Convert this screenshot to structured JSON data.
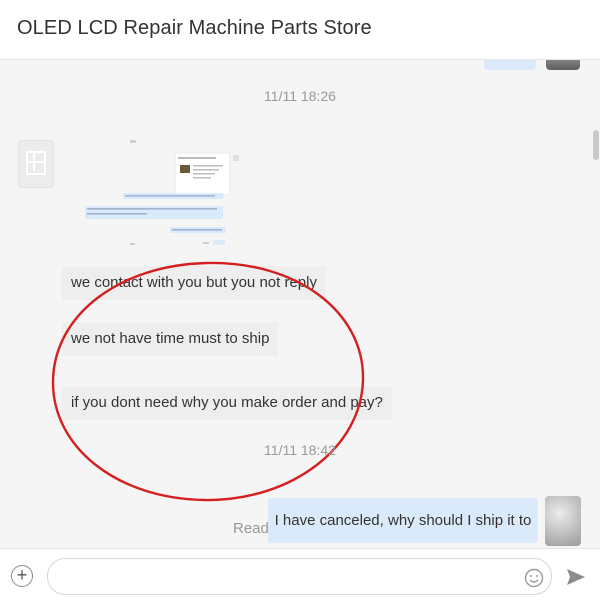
{
  "header": {
    "title": "OLED LCD Repair Machine Parts Store"
  },
  "chat": {
    "timestamps": [
      "11/11 18:26",
      "11/11 18:42"
    ],
    "shop_messages": [
      "we contact with you but you not reply",
      "we not have time must to ship",
      "if you dont need why you make order and pay?"
    ],
    "my_message": "I have canceled, why should I ship it to me?",
    "read_status": "Read"
  },
  "footer": {
    "input_value": "",
    "input_placeholder": ""
  },
  "icons": {
    "shop_avatar": "store-icon",
    "attach": "plus-icon",
    "emoji": "smiley-icon",
    "send": "send-arrow-icon"
  },
  "colors": {
    "my_bubble": "#dbeafa",
    "shop_bubble": "#eeeeee",
    "annotation": "#d42020"
  }
}
